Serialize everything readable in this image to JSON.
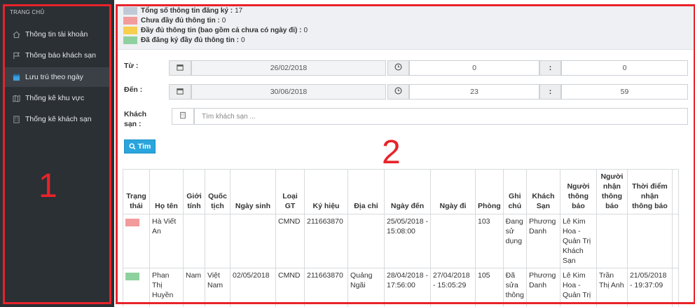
{
  "sidebar": {
    "header": "TRANG CHỦ",
    "items": [
      {
        "label": "Thông tin tài khoản",
        "icon": "home-icon"
      },
      {
        "label": "Thông báo khách sạn",
        "icon": "flag-icon"
      },
      {
        "label": "Lưu trú theo ngày",
        "icon": "calendar-icon",
        "active": true
      },
      {
        "label": "Thống kê khu vực",
        "icon": "map-icon"
      },
      {
        "label": "Thống kê khách sạn",
        "icon": "building-icon"
      }
    ],
    "annotation_number": "1"
  },
  "main": {
    "annotation_number": "2"
  },
  "legend": [
    {
      "label": "Tổng số thông tin đăng ký :",
      "value": "17",
      "color": "#bfc9d6"
    },
    {
      "label": "Chưa đầy đủ thông tin :",
      "value": "0",
      "color": "#f29b9b"
    },
    {
      "label": "Đầy đủ thông tin (bao gồm cả chưa có ngày đi) :",
      "value": "0",
      "color": "#f6cf4f"
    },
    {
      "label": "Đã đăng ký đầy đủ thông tin :",
      "value": "0",
      "color": "#8fd19e"
    }
  ],
  "filters": {
    "from_label": "Từ :",
    "from_date": "26/02/2018",
    "from_hour": "0",
    "from_minute": "0",
    "to_label": "Đến :",
    "to_date": "30/06/2018",
    "to_hour": "23",
    "to_minute": "59",
    "time_separator": ":",
    "hotel_label_line1": "Khách",
    "hotel_label_line2": "sạn :",
    "hotel_placeholder": "Tìm khách sạn ...",
    "search_button": "Tìm"
  },
  "table": {
    "columns": [
      "Trạng thái",
      "Họ tên",
      "Giới tính",
      "Quốc tịch",
      "Ngày sinh",
      "Loại GT",
      "Ký hiệu",
      "Địa chỉ",
      "Ngày đến",
      "Ngày đi",
      "Phòng",
      "Ghi chú",
      "Khách Sạn",
      "Người thông báo",
      "Người nhận thông báo",
      "Thời điểm nhận thông báo"
    ],
    "rows": [
      {
        "status_color": "#f29b9b",
        "cells": [
          "Hà Viết An",
          "",
          "",
          "",
          "CMND",
          "211663870",
          "",
          "25/05/2018 - 15:08:00",
          "",
          "103",
          "Đang sử dụng",
          "Phương Danh",
          "Lê Kim Hoa - Quản Trị Khách Sạn",
          "",
          ""
        ]
      },
      {
        "status_color": "#8fd19e",
        "cells": [
          "Phan Thị Huyền",
          "Nam",
          "Việt Nam",
          "02/05/2018",
          "CMND",
          "211663870",
          "Quảng Ngãi",
          "28/04/2018 - 17:56:00",
          "27/04/2018 - 15:05:29",
          "105",
          "Đã sửa thông",
          "Phương Danh",
          "Lê Kim Hoa - Quản Trị",
          "Trần Thị Anh",
          "21/05/2018 - 19:37:09"
        ]
      }
    ]
  }
}
